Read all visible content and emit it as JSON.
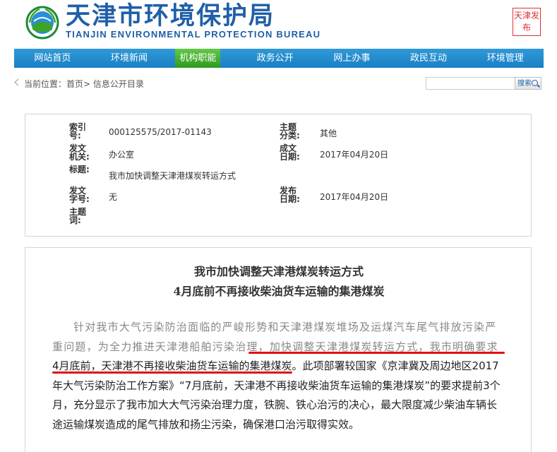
{
  "header": {
    "title_cn": "天津市环境保护局",
    "title_en": "TIANJIN ENVIRONMENTAL PROTECTION BUREAU",
    "seal_text": "天津发布",
    "brand_color": "#1f5fa8"
  },
  "nav": {
    "items": [
      {
        "label": "网站首页"
      },
      {
        "label": "环境新闻"
      },
      {
        "label": "机构职能"
      },
      {
        "label": "政务公开"
      },
      {
        "label": "网上办事"
      },
      {
        "label": "政民互动"
      },
      {
        "label": "环境管理"
      }
    ],
    "active_color": "#3aa526",
    "bar_color": "#1a7fc4"
  },
  "breadcrumb": {
    "text": "当前位置：首页> 信息公开目录"
  },
  "search": {
    "placeholder": "",
    "button_label": "搜索"
  },
  "meta": {
    "index_label": "索引号:",
    "index_value": "000125575/2017-01143",
    "category_label": "主题分类:",
    "category_value": "其他",
    "issuer_label": "发文机关:",
    "issuer_value": "办公室",
    "date_label": "成文日期:",
    "date_value": "2017年04月20日",
    "title_label": "标题:",
    "title_value": "我市加快调整天津港煤炭转运方式",
    "docno_label": "发文字号:",
    "docno_value": "无",
    "pubdate_label": "发布日期:",
    "pubdate_value": "2017年04月20日",
    "keywords_label": "主题词:",
    "keywords_value": ""
  },
  "article": {
    "headline_1": "我市加快调整天津港煤炭转运方式",
    "headline_2": "4月底前不再接收柴油货车运输的集港煤炭",
    "p1": "针对我市大气污染防治面临的严峻形势和天津港煤炭堆场及运煤汽车尾气排放污染严重问题，为全力推进天津港船舶污染治理，",
    "p2": "加快调整天津港煤炭转运方式，我市明确要求",
    "p3": "4月底前，天津港不再接收柴油货车运输的集港煤炭",
    "p4": "。此项部署较国家《京津冀及周边地区2017年大气污染防治工作方案》“7月底前，天津港不再接收柴油货车运输的集港煤炭”的要求提前3个月，充分显示了我市加大大气污染治理力度，铁腕、铁心治污的决心，最大限度减少柴油车辆长途运输煤炭造成的尾气排放和扬尘污染，确保港口治污取得实效。",
    "highlight_color": "#e01010"
  }
}
